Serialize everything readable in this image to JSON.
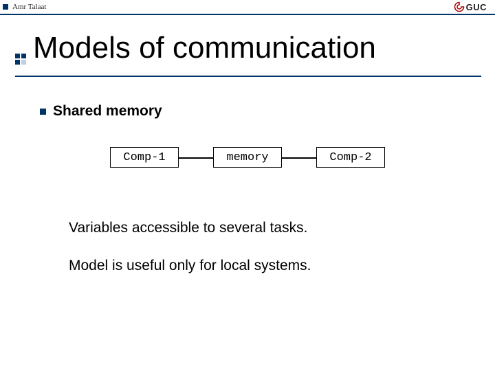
{
  "header": {
    "author": "Amr Talaat",
    "logo_text": "GUC"
  },
  "title": "Models of communication",
  "bullet": "Shared memory",
  "diagram": {
    "box1": "Comp-1",
    "box2": "memory",
    "box3": "Comp-2"
  },
  "paragraphs": {
    "p1": "Variables accessible to several tasks.",
    "p2": "Model is useful only for local systems."
  }
}
